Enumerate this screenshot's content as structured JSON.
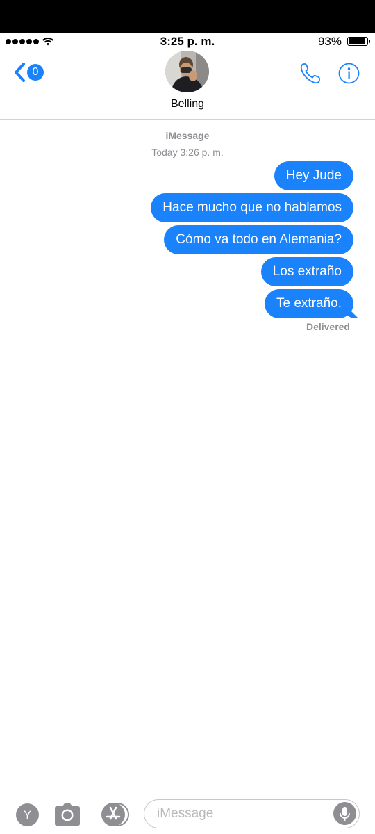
{
  "status_bar": {
    "time": "3:25 p. m.",
    "battery_percent": "93%",
    "signal_bars": 5,
    "battery_level": 0.93,
    "icons": [
      "signal-dots-icon",
      "wifi-icon",
      "battery-icon"
    ]
  },
  "nav": {
    "back_badge": "0",
    "contact_name": "Belling",
    "icons": [
      "back-chevron-icon",
      "phone-icon",
      "info-icon"
    ]
  },
  "conversation": {
    "service": "iMessage",
    "timestamp_day": "Today",
    "timestamp_time": "3:26 p. m.",
    "messages": [
      {
        "text": "Hey Jude",
        "from": "me"
      },
      {
        "text": "Hace mucho que no hablamos",
        "from": "me"
      },
      {
        "text": "Cómo va todo en Alemania?",
        "from": "me"
      },
      {
        "text": "Los extraño",
        "from": "me"
      },
      {
        "text": "Te extraño.",
        "from": "me"
      }
    ],
    "delivery_status": "Delivered"
  },
  "input_bar": {
    "y_button_label": "Y",
    "placeholder": "iMessage",
    "value": "",
    "icons": [
      "camera-icon",
      "app-store-icon",
      "microphone-icon"
    ]
  },
  "colors": {
    "accent": "#1a82fb",
    "gray_text": "#8e8e93",
    "bubble_text": "#ffffff"
  }
}
